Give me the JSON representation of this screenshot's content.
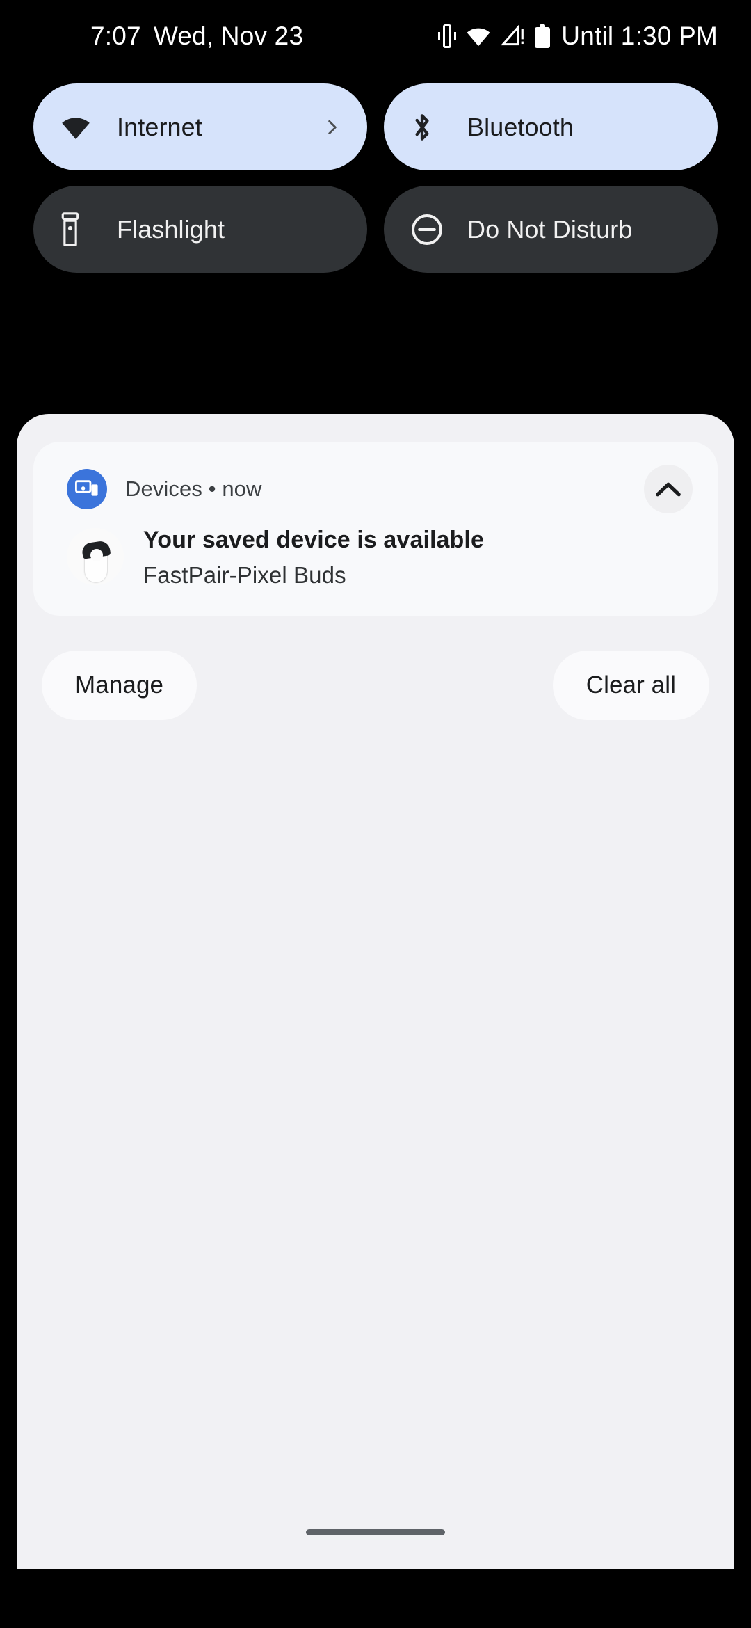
{
  "status_bar": {
    "time": "7:07",
    "date": "Wed, Nov 23",
    "battery_estimate": "Until 1:30 PM",
    "icons": [
      "vibrate-icon",
      "wifi-icon",
      "cellular-signal-alert-icon",
      "battery-icon"
    ]
  },
  "quick_settings": {
    "tiles": [
      {
        "id": "internet",
        "label": "Internet",
        "icon": "wifi-icon",
        "state": "on",
        "has_chevron": true
      },
      {
        "id": "bluetooth",
        "label": "Bluetooth",
        "icon": "bluetooth-icon",
        "state": "on",
        "has_chevron": false
      },
      {
        "id": "flashlight",
        "label": "Flashlight",
        "icon": "flashlight-icon",
        "state": "off",
        "has_chevron": false
      },
      {
        "id": "do-not-disturb",
        "label": "Do Not Disturb",
        "icon": "dnd-minus-circle-icon",
        "state": "off",
        "has_chevron": false
      }
    ]
  },
  "notification_shade": {
    "notification": {
      "app_name": "Devices",
      "separator": "•",
      "time": "now",
      "header_text": "Devices • now",
      "title": "Your saved device is available",
      "subtitle": "FastPair-Pixel Buds",
      "app_icon": "devices-icon",
      "thumbnail": "pixel-buds-case-icon",
      "collapse_icon": "chevron-up-icon"
    },
    "footer": {
      "manage_label": "Manage",
      "clear_all_label": "Clear all"
    }
  },
  "navigation": {
    "home_indicator": "home-gesture-bar"
  },
  "colors": {
    "background": "#000000",
    "tile_active_bg": "#D6E3FB",
    "tile_inactive_bg": "#303336",
    "shade_bg": "#F1F1F4",
    "notification_bg": "#F8F9FB",
    "app_icon_blue": "#3B74DB",
    "text_dark": "#1B1C1E",
    "text_light": "#F1F1F1"
  }
}
